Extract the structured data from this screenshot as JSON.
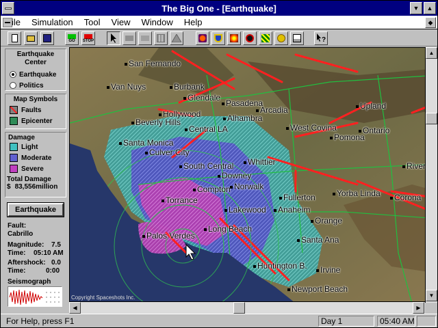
{
  "window": {
    "title": "The Big One - [Earthquake]",
    "min_glyph": "▼",
    "max_glyph": "▲",
    "restore_glyph": "◆"
  },
  "menu": [
    "File",
    "Simulation",
    "Tool",
    "View",
    "Window",
    "Help"
  ],
  "toolbar": {
    "go_label": "GO",
    "stop_label": "STOP"
  },
  "sidebar": {
    "center_heading": "Earthquake Center",
    "center_options": [
      {
        "label": "Earthquake",
        "selected": true
      },
      {
        "label": "Politics",
        "selected": false
      }
    ],
    "symbols_heading": "Map Symbols",
    "symbols": [
      {
        "label": "Faults",
        "color": "#ff4040"
      },
      {
        "label": "Epicenter",
        "color": "#2e8b57"
      }
    ],
    "damage_heading": "Damage",
    "damage": [
      {
        "label": "Light",
        "color": "#40c0c0"
      },
      {
        "label": "Moderate",
        "color": "#6060d0"
      },
      {
        "label": "Severe",
        "color": "#c040c0"
      }
    ],
    "total_damage_label": "Total Damage",
    "total_damage_currency": "$",
    "total_damage_value": "83,556million",
    "earthquake_button": "Earthquake",
    "fault_label": "Fault:",
    "fault_value": "Cabrillo",
    "magnitude_label": "Magnitude:",
    "magnitude_value": "7.5",
    "time_label": "Time:",
    "time_value": "05:10 AM",
    "aftershock_label": "Aftershock:",
    "aftershock_value": "0.0",
    "aftershock_time_label": "Time:",
    "aftershock_time_value": "0:00",
    "seismograph_label": "Seismograph"
  },
  "map": {
    "copyright": "Copyright Spaceshots Inc.",
    "cities": [
      {
        "name": "San Fernando"
      },
      {
        "name": "Van Nuys"
      },
      {
        "name": "Burbank"
      },
      {
        "name": "Glendale"
      },
      {
        "name": "Pasadena"
      },
      {
        "name": "Arcadia"
      },
      {
        "name": "Upland"
      },
      {
        "name": "Hollywood"
      },
      {
        "name": "Alhambra"
      },
      {
        "name": "Beverly Hills"
      },
      {
        "name": "Central LA"
      },
      {
        "name": "West Covina"
      },
      {
        "name": "Ontario"
      },
      {
        "name": "Pomona"
      },
      {
        "name": "Santa Monica"
      },
      {
        "name": "Culver City"
      },
      {
        "name": "Whittier"
      },
      {
        "name": "South Central"
      },
      {
        "name": "Downey"
      },
      {
        "name": "Riverside"
      },
      {
        "name": "Compton"
      },
      {
        "name": "Norwalk"
      },
      {
        "name": "Fullerton"
      },
      {
        "name": "Yorba Linda"
      },
      {
        "name": "Corona"
      },
      {
        "name": "Torrance"
      },
      {
        "name": "Lakewood"
      },
      {
        "name": "Anaheim"
      },
      {
        "name": "Long Beach"
      },
      {
        "name": "Orange"
      },
      {
        "name": "Palos Verdes"
      },
      {
        "name": "Santa Ana"
      },
      {
        "name": "Huntington B."
      },
      {
        "name": "Irvine"
      },
      {
        "name": "Newport Beach"
      }
    ]
  },
  "status": {
    "help": "For Help, press F1",
    "day": "Day 1",
    "clock": "05:40 AM"
  }
}
